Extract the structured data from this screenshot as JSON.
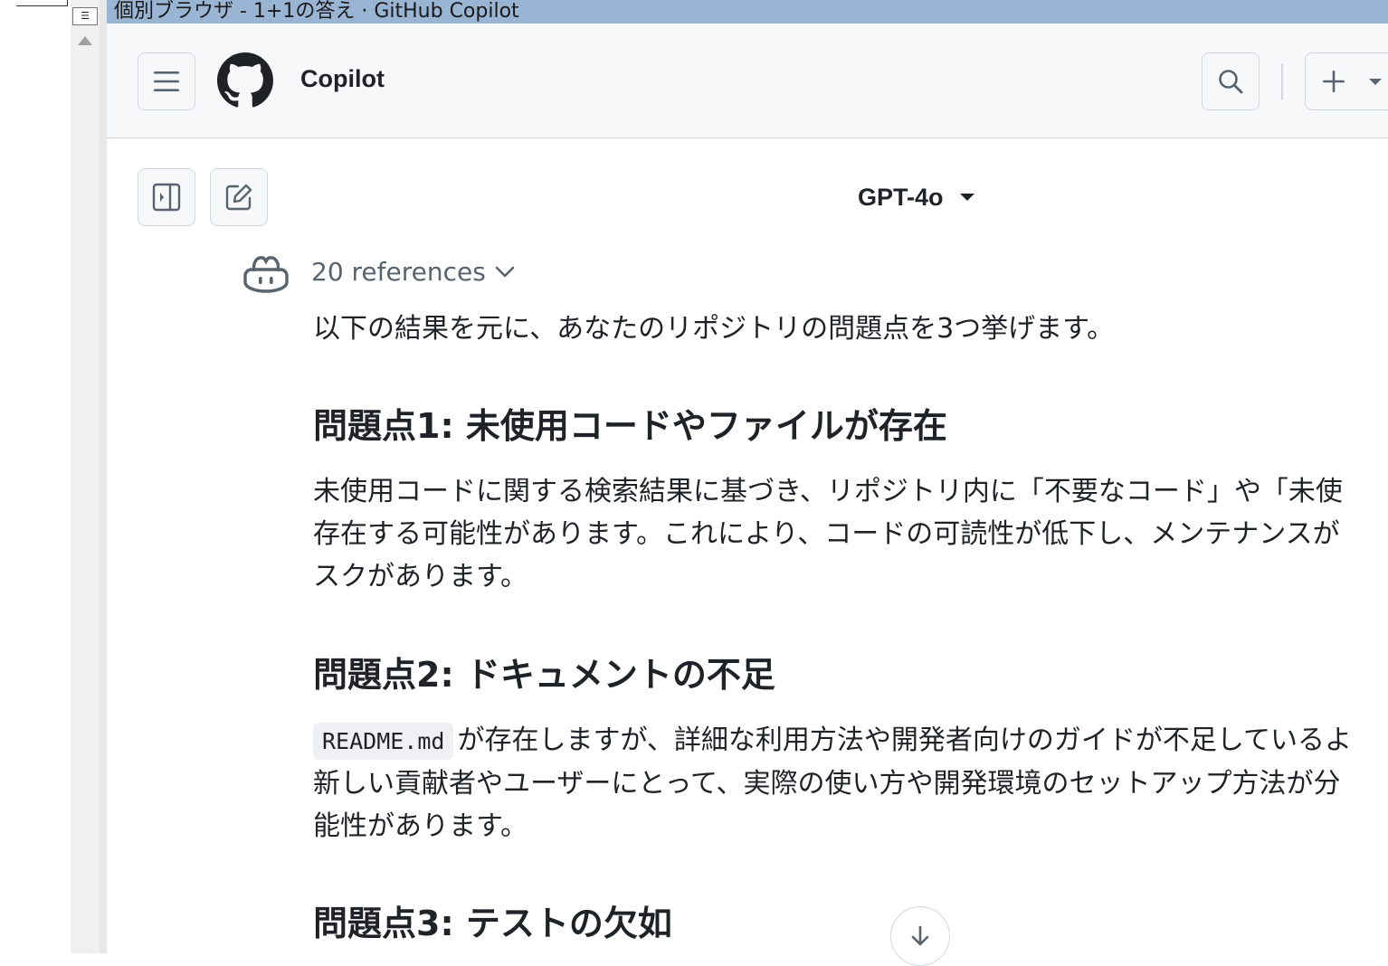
{
  "window": {
    "title": "個別ブラウザ - 1+1の答え · GitHub Copilot"
  },
  "header": {
    "app_title": "Copilot",
    "icons": {
      "menu": "hamburger-icon",
      "logo": "github-logo-icon",
      "search": "search-icon",
      "new": "plus-icon"
    }
  },
  "toolbar": {
    "model_label": "GPT-4o",
    "icons": {
      "sidebar": "sidebar-toggle-icon",
      "new_chat": "edit-icon"
    }
  },
  "message": {
    "references_label": "20 references",
    "intro": "以下の結果を元に、あなたのリポジトリの問題点を3つ挙げます。",
    "sections": [
      {
        "heading": "問題点1: 未使用コードやファイルが存在",
        "lines": [
          "未使用コードに関する検索結果に基づき、リポジトリ内に「不要なコード」や「未使",
          "存在する可能性があります。これにより、コードの可読性が低下し、メンテナンスが",
          "スクがあります。"
        ]
      },
      {
        "heading": "問題点2: ドキュメントの不足",
        "code": "README.md",
        "lines": [
          "が存在しますが、詳細な利用方法や開発者向けのガイドが不足しているよ",
          "新しい貢献者やユーザーにとって、実際の使い方や開発環境のセットアップ方法が分",
          "能性があります。"
        ]
      },
      {
        "heading": "問題点3: テストの欠如"
      }
    ]
  },
  "colors": {
    "titlebar": "#9ab4d4",
    "header_bg": "#f6f8fa",
    "border": "#d0d7de",
    "text": "#1f2328",
    "muted": "#59636e"
  }
}
